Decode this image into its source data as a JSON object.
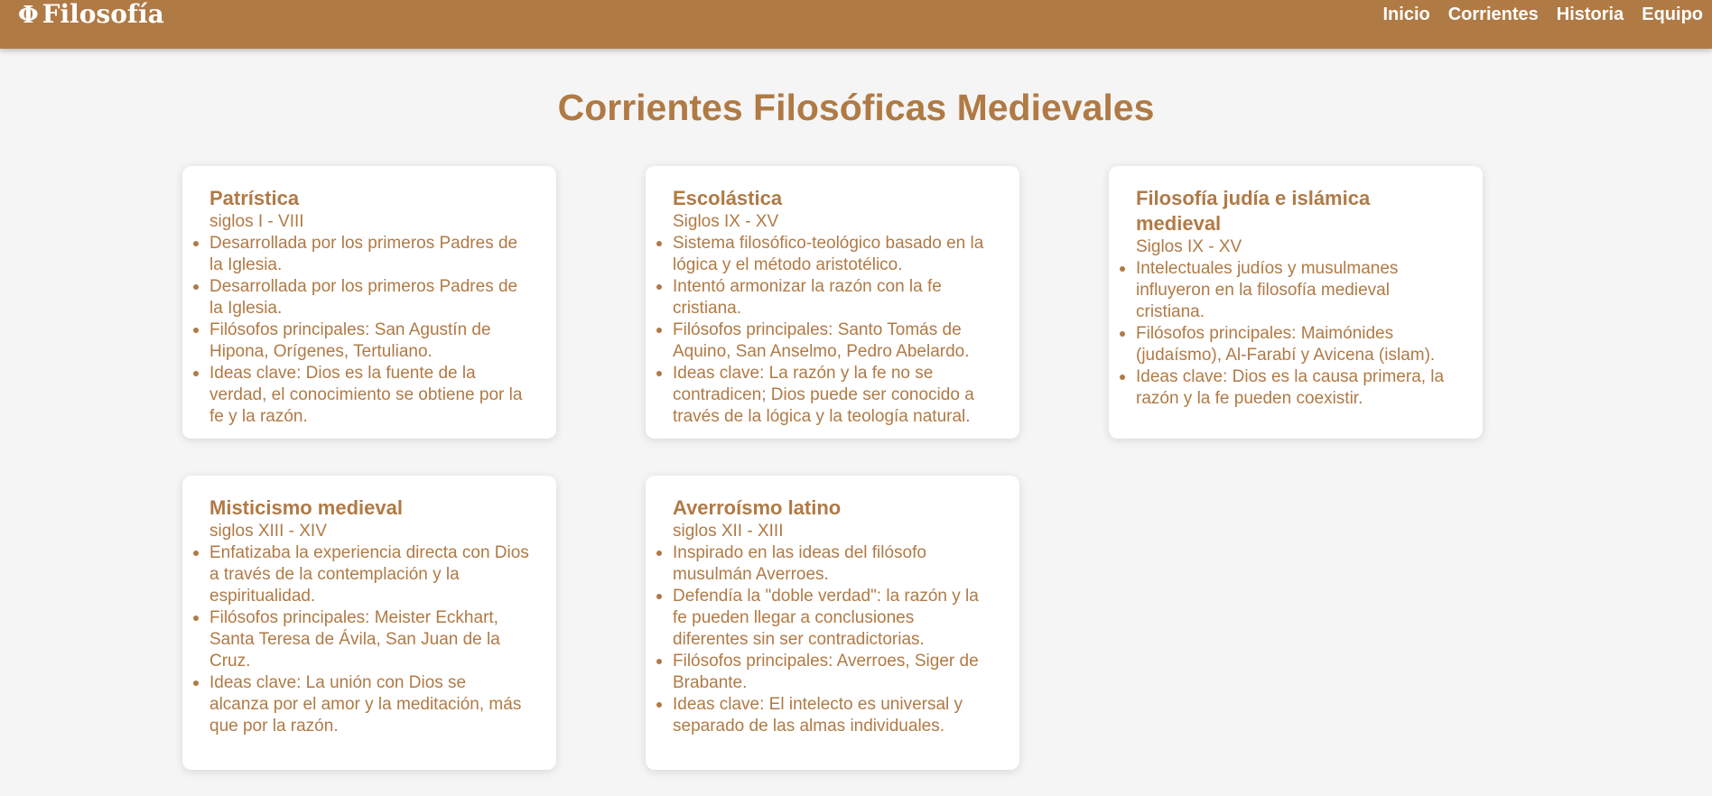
{
  "navbar": {
    "brand_symbol": "Φ",
    "brand_text": "Filosofía",
    "links": [
      "Inicio",
      "Corrientes",
      "Historia",
      "Equipo"
    ]
  },
  "page": {
    "title": "Corrientes Filosóficas Medievales"
  },
  "cards": [
    {
      "title": "Patrística",
      "period": "siglos I - VIII",
      "items": [
        "Desarrollada por los primeros Padres de la Iglesia.",
        "Desarrollada por los primeros Padres de la Iglesia.",
        "Filósofos principales: San Agustín de Hipona, Orígenes, Tertuliano.",
        "Ideas clave: Dios es la fuente de la verdad, el conocimiento se obtiene por la fe y la razón."
      ]
    },
    {
      "title": "Escolástica",
      "period": "Siglos IX - XV",
      "items": [
        "Sistema filosófico-teológico basado en la lógica y el método aristotélico.",
        "Intentó armonizar la razón con la fe cristiana.",
        "Filósofos principales: Santo Tomás de Aquino, San Anselmo, Pedro Abelardo.",
        "Ideas clave: La razón y la fe no se contradicen; Dios puede ser conocido a través de la lógica y la teología natural."
      ]
    },
    {
      "title": "Filosofía judía e islámica medieval",
      "period": "Siglos IX - XV",
      "items": [
        "Intelectuales judíos y musulmanes influyeron en la filosofía medieval cristiana.",
        "Filósofos principales: Maimónides (judaísmo), Al-Farabí y Avicena (islam).",
        "Ideas clave: Dios es la causa primera, la razón y la fe pueden coexistir."
      ]
    },
    {
      "title": "Misticismo medieval",
      "period": "siglos XIII - XIV",
      "items": [
        "Enfatizaba la experiencia directa con Dios a través de la contemplación y la espiritualidad.",
        "Filósofos principales: Meister Eckhart, Santa Teresa de Ávila, San Juan de la Cruz.",
        "Ideas clave: La unión con Dios se alcanza por el amor y la meditación, más que por la razón."
      ]
    },
    {
      "title": "Averroísmo latino",
      "period": "siglos XII - XIII",
      "items": [
        "Inspirado en las ideas del filósofo musulmán Averroes.",
        "Defendía la \"doble verdad\": la razón y la fe pueden llegar a conclusiones diferentes sin ser contradictorias.",
        "Filósofos principales: Averroes, Siger de Brabante.",
        "Ideas clave: El intelecto es universal y separado de las almas individuales."
      ]
    }
  ],
  "colors": {
    "brand": "#b07a45",
    "background": "#f5f5f5",
    "card": "#ffffff",
    "nav_text": "#ffffff"
  }
}
